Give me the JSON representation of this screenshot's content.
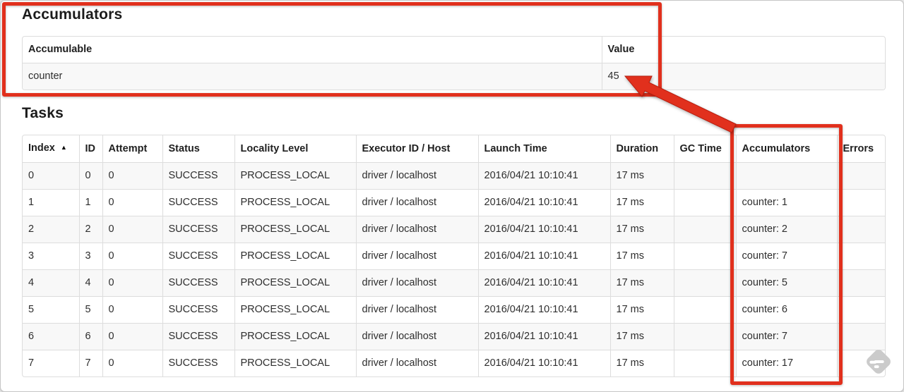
{
  "accumulators_section": {
    "title": "Accumulators",
    "table": {
      "headers": [
        "Accumulable",
        "Value"
      ],
      "rows": [
        [
          "counter",
          "45"
        ]
      ]
    }
  },
  "tasks_section": {
    "title": "Tasks",
    "table": {
      "sort_icon": "▲",
      "sorted_column": "Index",
      "headers": [
        "Index",
        "ID",
        "Attempt",
        "Status",
        "Locality Level",
        "Executor ID / Host",
        "Launch Time",
        "Duration",
        "GC Time",
        "Accumulators",
        "Errors"
      ],
      "rows": [
        [
          "0",
          "0",
          "0",
          "SUCCESS",
          "PROCESS_LOCAL",
          "driver / localhost",
          "2016/04/21 10:10:41",
          "17 ms",
          "",
          "",
          ""
        ],
        [
          "1",
          "1",
          "0",
          "SUCCESS",
          "PROCESS_LOCAL",
          "driver / localhost",
          "2016/04/21 10:10:41",
          "17 ms",
          "",
          "counter: 1",
          ""
        ],
        [
          "2",
          "2",
          "0",
          "SUCCESS",
          "PROCESS_LOCAL",
          "driver / localhost",
          "2016/04/21 10:10:41",
          "17 ms",
          "",
          "counter: 2",
          ""
        ],
        [
          "3",
          "3",
          "0",
          "SUCCESS",
          "PROCESS_LOCAL",
          "driver / localhost",
          "2016/04/21 10:10:41",
          "17 ms",
          "",
          "counter: 7",
          ""
        ],
        [
          "4",
          "4",
          "0",
          "SUCCESS",
          "PROCESS_LOCAL",
          "driver / localhost",
          "2016/04/21 10:10:41",
          "17 ms",
          "",
          "counter: 5",
          ""
        ],
        [
          "5",
          "5",
          "0",
          "SUCCESS",
          "PROCESS_LOCAL",
          "driver / localhost",
          "2016/04/21 10:10:41",
          "17 ms",
          "",
          "counter: 6",
          ""
        ],
        [
          "6",
          "6",
          "0",
          "SUCCESS",
          "PROCESS_LOCAL",
          "driver / localhost",
          "2016/04/21 10:10:41",
          "17 ms",
          "",
          "counter: 7",
          ""
        ],
        [
          "7",
          "7",
          "0",
          "SUCCESS",
          "PROCESS_LOCAL",
          "driver / localhost",
          "2016/04/21 10:10:41",
          "17 ms",
          "",
          "counter: 17",
          ""
        ]
      ]
    }
  },
  "annotations": {
    "accent_color": "#e1301d",
    "arrow_points_to": "45",
    "highlighted_regions": [
      "accumulators-summary-table",
      "tasks-accumulators-column"
    ]
  },
  "watermark": {
    "icon": "feedly-badge-icon",
    "color": "#cbcbcb"
  }
}
